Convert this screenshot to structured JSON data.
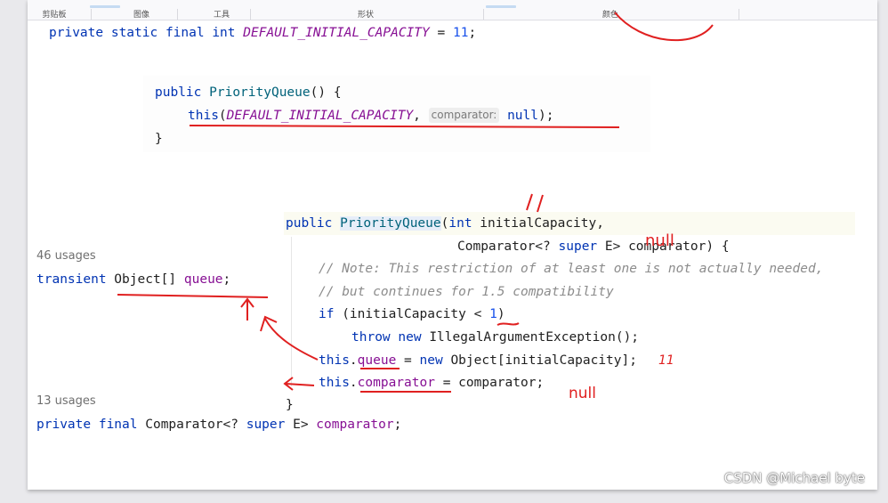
{
  "ribbon": {
    "groups": [
      "剪贴板",
      "图像",
      "工具",
      "形状",
      "颜色"
    ]
  },
  "code": {
    "line_capacity": {
      "kw": "private static final int",
      "const": "DEFAULT_INITIAL_CAPACITY",
      "rest": " = ",
      "num": "11",
      "end": ";"
    },
    "ctor1": {
      "sig_kw": "public",
      "sig_name": "PriorityQueue",
      "sig_end": "() {",
      "call_kw": "this",
      "call_open": "(",
      "call_const": "DEFAULT_INITIAL_CAPACITY",
      "call_comma": ",",
      "hint": "comparator:",
      "call_null": "null",
      "call_end": ");",
      "close": "}"
    },
    "queue_usages": "46 usages",
    "queue_line": {
      "kw": "transient",
      "type": " Object[] ",
      "field": "queue",
      "end": ";"
    },
    "comparator_usages": "13 usages",
    "comparator_line": {
      "kw1": "private final",
      "type1": " Comparator<? ",
      "kw2": "super",
      "type2": " E> ",
      "field": "comparator",
      "end": ";"
    },
    "ctor2": {
      "l1_kw": "public",
      "l1_name": "PriorityQueue",
      "l1_open": "(",
      "l1_kw2": "int",
      "l1_rest": " initialCapacity,",
      "l2_type": "Comparator<? ",
      "l2_kw": "super",
      "l2_type2": " E> comparator) {",
      "c1": "// Note: This restriction of at least one is not actually needed,",
      "c2": "// but continues for 1.5 compatibility",
      "if_kw": "if",
      "if_rest": " (initialCapacity < ",
      "if_num": "1",
      "if_end": ")",
      "throw_kw": "throw",
      "throw_new": "new",
      "throw_rest": " IllegalArgumentException();",
      "q_this": "this",
      "q_dot": ".",
      "q_field": "queue",
      "q_eq": " = ",
      "q_new": "new",
      "q_rest": " Object[initialCapacity];",
      "c_this": "this",
      "c_dot": ".",
      "c_field": "comparator",
      "c_rest": " = comparator;",
      "close": "}"
    }
  },
  "annotations": {
    "null_top": "null",
    "null_bottom": "null",
    "eleven": "11"
  },
  "watermark": "CSDN @Michael byte",
  "colors": {
    "keyword": "#0033b3",
    "constant": "#871094",
    "number": "#1750eb",
    "comment": "#8c8c8c",
    "ink": "#e02020"
  }
}
